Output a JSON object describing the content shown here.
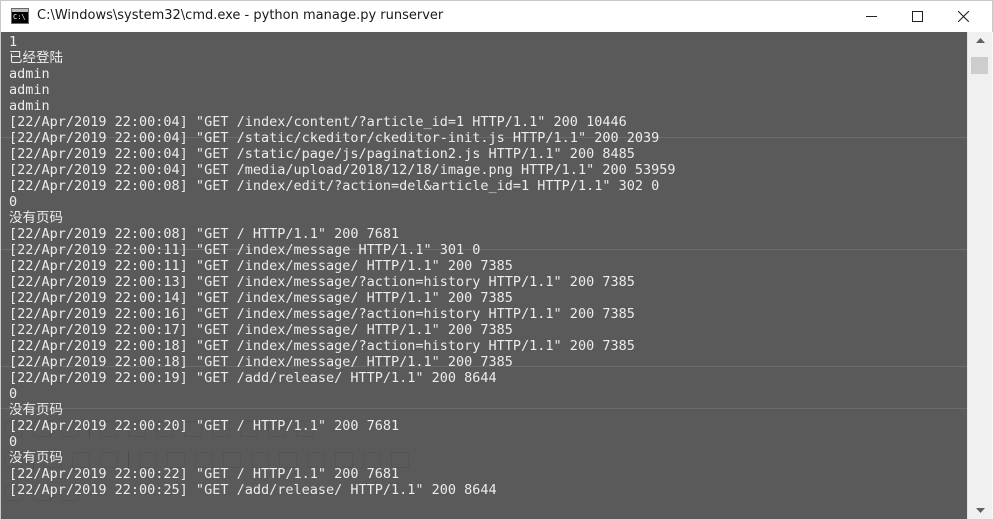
{
  "window": {
    "title": "C:\\Windows\\system32\\cmd.exe - python  manage.py runserver",
    "icon": "console-app-icon",
    "icon_glyph": "C:\\",
    "controls": {
      "minimize_icon": "minimize-icon",
      "maximize_icon": "maximize-icon",
      "close_icon": "close-icon"
    }
  },
  "colors": {
    "console_background": "#5a5a5a",
    "console_text": "#ececec",
    "titlebar": "#ffffff",
    "scrollbar_track": "#f0f0f0",
    "scrollbar_thumb": "#cdcdcd"
  },
  "console": {
    "lines": [
      "1",
      "已经登陆",
      "admin",
      "admin",
      "admin",
      "[22/Apr/2019 22:00:04] \"GET /index/content/?article_id=1 HTTP/1.1\" 200 10446",
      "[22/Apr/2019 22:00:04] \"GET /static/ckeditor/ckeditor-init.js HTTP/1.1\" 200 2039",
      "[22/Apr/2019 22:00:04] \"GET /static/page/js/pagination2.js HTTP/1.1\" 200 8485",
      "[22/Apr/2019 22:00:04] \"GET /media/upload/2018/12/18/image.png HTTP/1.1\" 200 53959",
      "[22/Apr/2019 22:00:08] \"GET /index/edit/?action=del&article_id=1 HTTP/1.1\" 302 0",
      "0",
      "没有页码",
      "[22/Apr/2019 22:00:08] \"GET / HTTP/1.1\" 200 7681",
      "[22/Apr/2019 22:00:11] \"GET /index/message HTTP/1.1\" 301 0",
      "[22/Apr/2019 22:00:11] \"GET /index/message/ HTTP/1.1\" 200 7385",
      "[22/Apr/2019 22:00:13] \"GET /index/message/?action=history HTTP/1.1\" 200 7385",
      "[22/Apr/2019 22:00:14] \"GET /index/message/ HTTP/1.1\" 200 7385",
      "[22/Apr/2019 22:00:16] \"GET /index/message/?action=history HTTP/1.1\" 200 7385",
      "[22/Apr/2019 22:00:17] \"GET /index/message/ HTTP/1.1\" 200 7385",
      "[22/Apr/2019 22:00:18] \"GET /index/message/?action=history HTTP/1.1\" 200 7385",
      "[22/Apr/2019 22:00:18] \"GET /index/message/ HTTP/1.1\" 200 7385",
      "[22/Apr/2019 22:00:19] \"GET /add/release/ HTTP/1.1\" 200 8644",
      "0",
      "没有页码",
      "[22/Apr/2019 22:00:20] \"GET / HTTP/1.1\" 200 7681",
      "0",
      "没有页码",
      "[22/Apr/2019 22:00:22] \"GET / HTTP/1.1\" 200 7681",
      "[22/Apr/2019 22:00:25] \"GET /add/release/ HTTP/1.1\" 200 8644"
    ]
  },
  "scrollbar": {
    "up_icon": "scroll-up-arrow-icon",
    "down_icon": "scroll-down-arrow-icon"
  }
}
